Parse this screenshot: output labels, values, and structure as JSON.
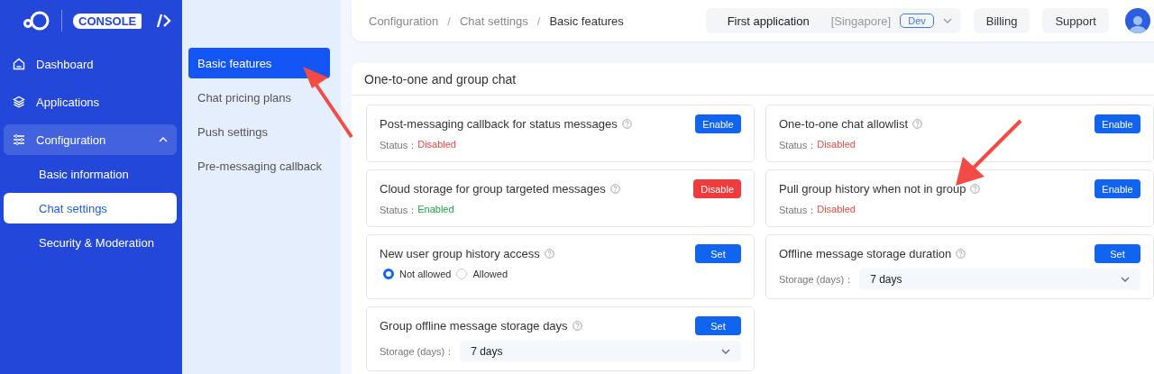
{
  "sidebar": {
    "logo_text": "CONSOLE",
    "items": [
      {
        "label": "Dashboard",
        "expanded": false
      },
      {
        "label": "Applications",
        "expanded": false
      },
      {
        "label": "Configuration",
        "expanded": true,
        "children": [
          {
            "label": "Basic information",
            "selected": false
          },
          {
            "label": "Chat settings",
            "selected": true
          },
          {
            "label": "Security & Moderation",
            "selected": false
          }
        ]
      }
    ]
  },
  "submenu": {
    "items": [
      {
        "label": "Basic features",
        "selected": true
      },
      {
        "label": "Chat pricing plans",
        "selected": false
      },
      {
        "label": "Push settings",
        "selected": false
      },
      {
        "label": "Pre-messaging callback",
        "selected": false
      }
    ]
  },
  "breadcrumb": {
    "separator": "/",
    "items": [
      "Configuration",
      "Chat settings",
      "Basic features"
    ]
  },
  "app_selector": {
    "name": "First application",
    "region": "[Singapore]",
    "env": "Dev"
  },
  "header_buttons": [
    "Billing",
    "Support"
  ],
  "section": {
    "title": "One-to-one and group chat",
    "columns": [
      [
        {
          "kind": "toggle",
          "title": "Post-messaging callback for status messages",
          "status_label": "Status：",
          "status": "Disabled",
          "enabled": false,
          "button": "Enable"
        },
        {
          "kind": "toggle",
          "title": "Cloud storage for group targeted messages",
          "status_label": "Status：",
          "status": "Enabled",
          "enabled": true,
          "button": "Disable"
        },
        {
          "kind": "radio",
          "title": "New user group history access",
          "button": "Set",
          "options": [
            {
              "label": "Not allowed",
              "selected": true
            },
            {
              "label": "Allowed",
              "selected": false
            }
          ]
        },
        {
          "kind": "select",
          "title": "Group offline message storage days",
          "button": "Set",
          "field_label": "Storage (days)：",
          "value": "7 days"
        }
      ],
      [
        {
          "kind": "toggle",
          "title": "One-to-one chat allowlist",
          "status_label": "Status：",
          "status": "Disabled",
          "enabled": false,
          "button": "Enable"
        },
        {
          "kind": "toggle",
          "title": "Pull group history when not in group",
          "status_label": "Status：",
          "status": "Disabled",
          "enabled": false,
          "button": "Enable"
        },
        {
          "kind": "select",
          "title": "Offline message storage duration",
          "button": "Set",
          "field_label": "Storage (days)：",
          "value": "7 days"
        }
      ]
    ]
  }
}
